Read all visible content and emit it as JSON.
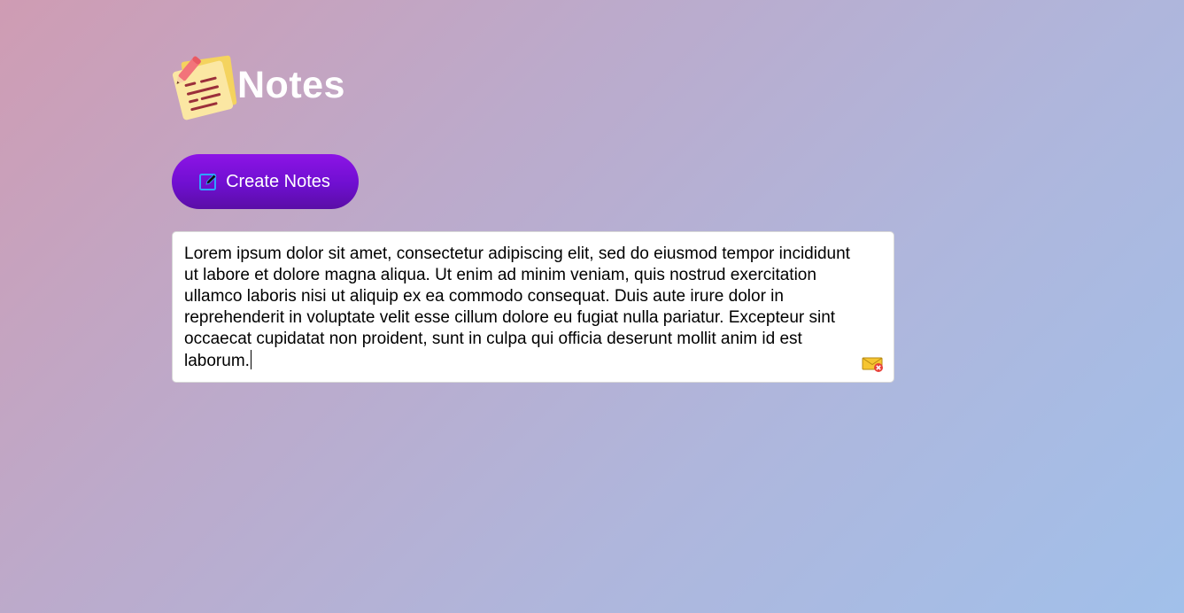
{
  "app": {
    "title": "Notes",
    "logo_icon": "sticky-note-pencil-icon"
  },
  "toolbar": {
    "create_label": "Create Notes",
    "create_icon": "edit-icon"
  },
  "notes": [
    {
      "text": "Lorem ipsum dolor sit amet, consectetur adipiscing elit, sed do eiusmod tempor incididunt ut labore et dolore magna aliqua. Ut enim ad minim veniam, quis nostrud exercitation ullamco laboris nisi ut aliquip ex ea commodo consequat. Duis aute irure dolor in reprehenderit in voluptate velit esse cillum dolore eu fugiat nulla pariatur. Excepteur sint occaecat cupidatat non proident, sunt in culpa qui officia deserunt mollit anim id est laborum.",
      "delete_icon": "delete-note-icon"
    }
  ],
  "colors": {
    "button_primary": "#7410d8",
    "title": "#ffffff",
    "note_bg": "#ffffff"
  }
}
